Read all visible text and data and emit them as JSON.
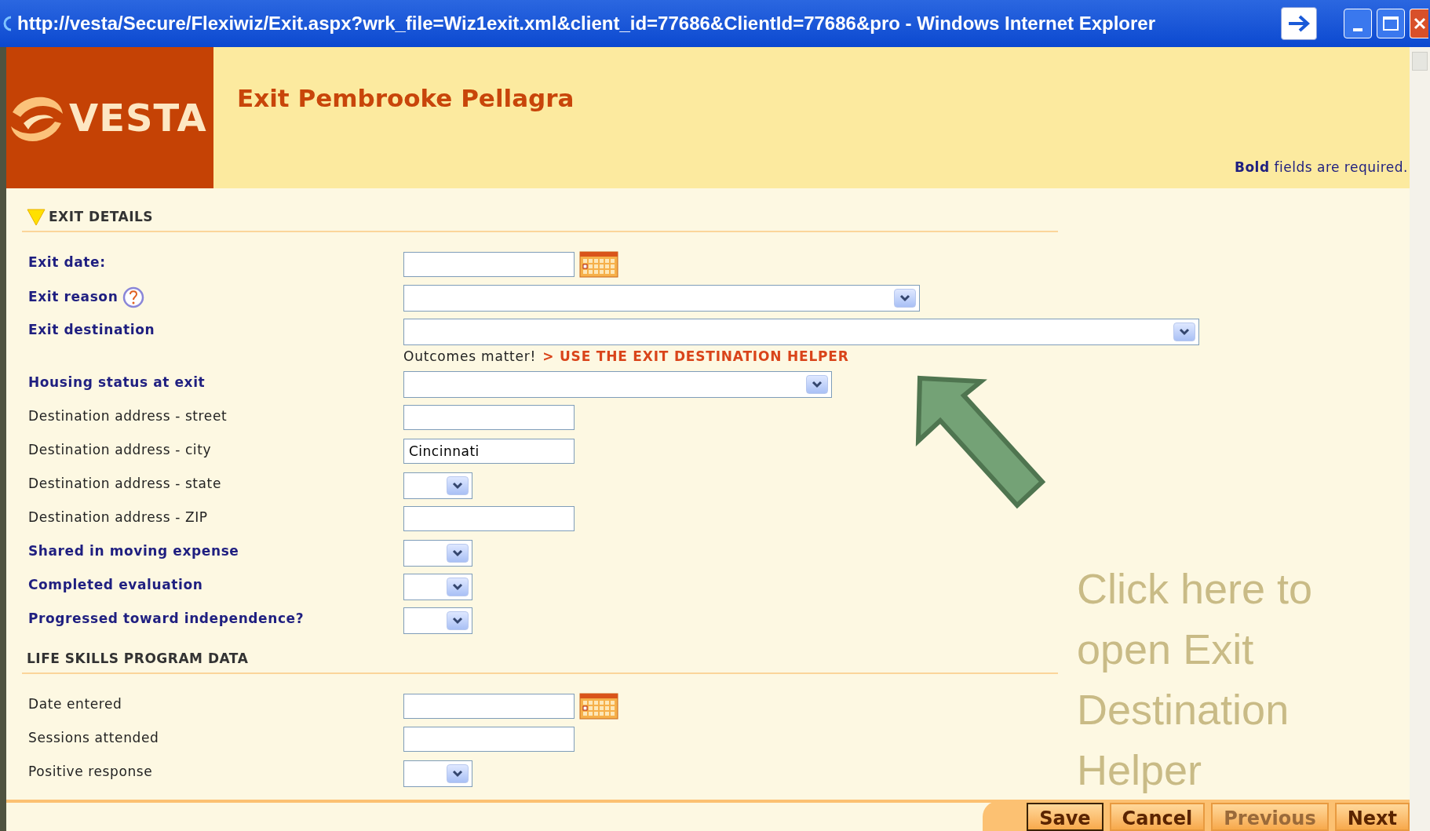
{
  "window": {
    "title": "http://vesta/Secure/Flexiwiz/Exit.aspx?wrk_file=Wiz1exit.xml&client_id=77686&ClientId=77686&pro - Windows Internet Explorer"
  },
  "header": {
    "logo": "VESTA",
    "title": "Exit Pembrooke Pellagra",
    "required_note": "**Bold** fields are required."
  },
  "sections": [
    {
      "title": "EXIT DETAILS",
      "expanded": true,
      "fields": [
        {
          "label": "Exit date:",
          "required": true,
          "kind": "date"
        },
        {
          "label": "Exit reason",
          "required": true,
          "help": true,
          "kind": "select_large"
        },
        {
          "label": "Exit destination",
          "required": true,
          "kind": "select_wide",
          "note": "Outcomes matter!",
          "link": "> USE THE EXIT DESTINATION HELPER"
        },
        {
          "label": "Housing status at exit",
          "required": true,
          "kind": "select_medium"
        },
        {
          "label": "Destination address - street",
          "required": false,
          "kind": "text"
        },
        {
          "label": "Destination address - city",
          "required": false,
          "kind": "text",
          "value": "Cincinnati"
        },
        {
          "label": "Destination address - state",
          "required": false,
          "kind": "select_small"
        },
        {
          "label": "Destination address - ZIP",
          "required": false,
          "kind": "text"
        },
        {
          "label": "Shared in moving expense",
          "required": true,
          "kind": "select_small"
        },
        {
          "label": "Completed evaluation",
          "required": true,
          "kind": "select_small"
        },
        {
          "label": "Progressed toward independence?",
          "required": true,
          "kind": "select_small"
        }
      ]
    },
    {
      "title": "LIFE SKILLS PROGRAM DATA",
      "fields": [
        {
          "label": "Date entered",
          "required": false,
          "kind": "date"
        },
        {
          "label": "Sessions attended",
          "required": false,
          "kind": "text"
        },
        {
          "label": "Positive response",
          "required": false,
          "kind": "select_small"
        }
      ]
    }
  ],
  "annotation": "Click here to open Exit Destination Helper",
  "buttons": [
    {
      "label": "Save",
      "selected": true,
      "disabled": false
    },
    {
      "label": "Cancel",
      "selected": false,
      "disabled": false
    },
    {
      "label": "Previous",
      "selected": false,
      "disabled": true
    },
    {
      "label": "Next",
      "selected": false,
      "disabled": false
    }
  ]
}
